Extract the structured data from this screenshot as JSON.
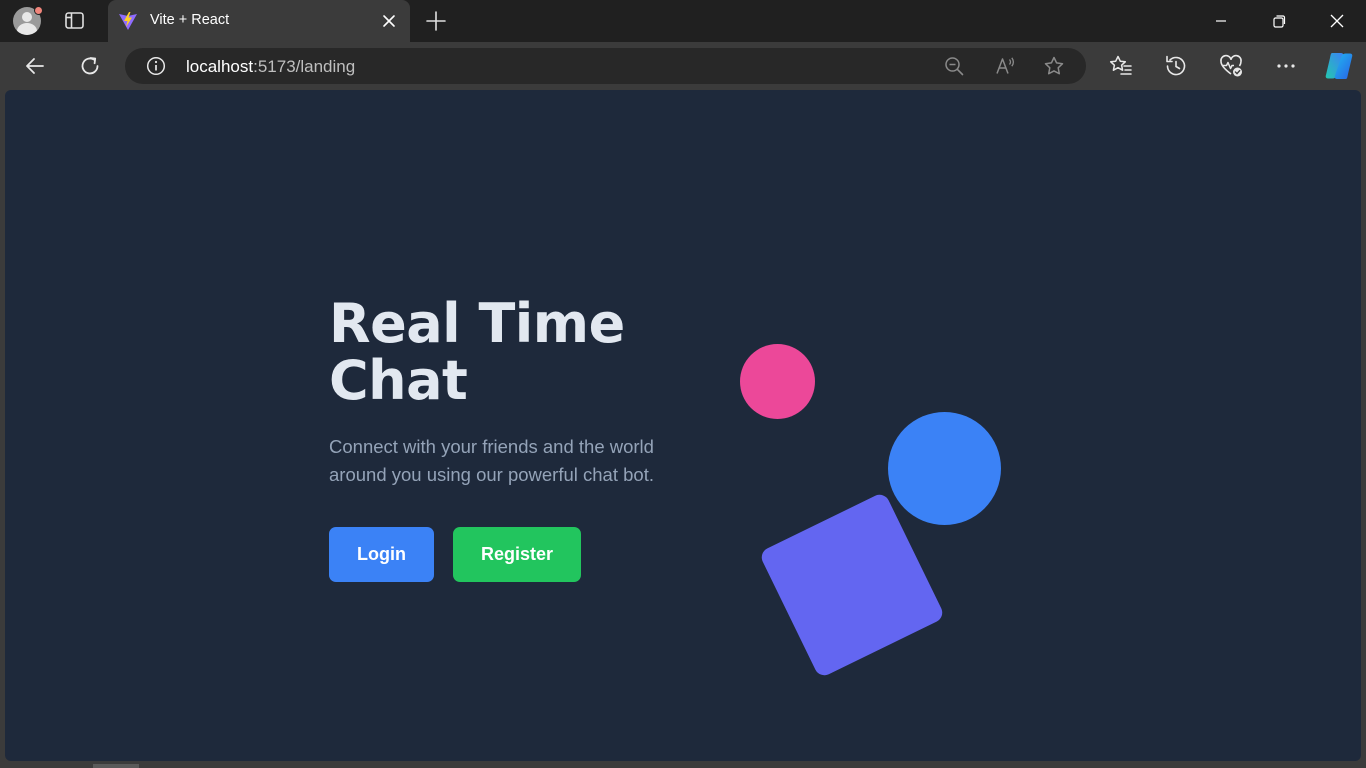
{
  "browser": {
    "tab": {
      "title": "Vite + React",
      "favicon": "vite-favicon-icon",
      "close_icon": "close-icon"
    },
    "new_tab_icon": "plus-icon",
    "window_controls": [
      "minimize-icon",
      "restore-icon",
      "close-icon"
    ],
    "nav": [
      "back-icon",
      "refresh-icon"
    ],
    "address": {
      "host": "localhost",
      "rest": ":5173/landing"
    },
    "address_icons": [
      "zoom-out-icon",
      "read-aloud-icon",
      "favorite-star-icon"
    ],
    "toolbar_icons": [
      "favorites-icon",
      "history-icon",
      "browser-essentials-icon",
      "more-icon",
      "copilot-icon"
    ]
  },
  "page": {
    "title_line1": "Real Time",
    "title_line2": "Chat",
    "subtitle": "Connect with your friends and the world around you using our powerful chat bot.",
    "login_label": "Login",
    "register_label": "Register"
  },
  "colors": {
    "background": "#1e293b",
    "title": "#e2e8f0",
    "subtitle": "#94a3b8",
    "login": "#3b82f6",
    "register": "#22c55e",
    "pink_circle": "#ec4899",
    "blue_circle": "#3b82f6",
    "square": "#6366f1"
  }
}
